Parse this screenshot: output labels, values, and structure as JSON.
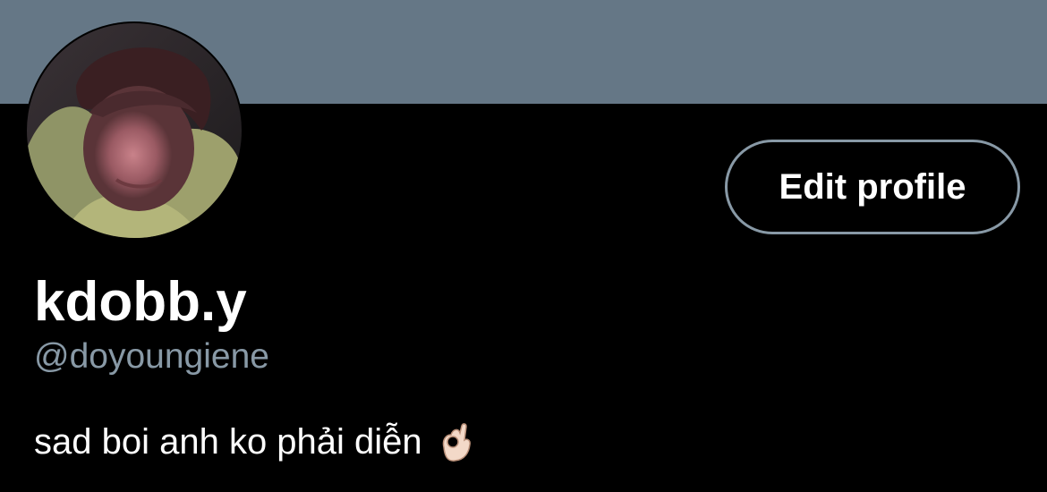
{
  "profile": {
    "display_name": "kdobb.y",
    "handle": "@doyoungiene",
    "bio": "sad boi anh ko phải diễn",
    "bio_emoji_icon": "ok-hand-icon",
    "edit_button_label": "Edit profile"
  },
  "colors": {
    "banner": "#657786",
    "background": "#000000",
    "text_primary": "#ffffff",
    "text_secondary": "#8899a6",
    "button_border": "#8899a6"
  }
}
